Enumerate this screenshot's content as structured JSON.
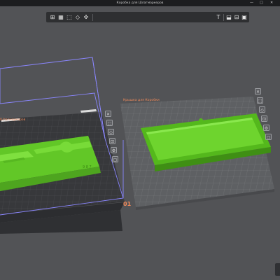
{
  "window": {
    "title": "Коробка для Шлагмаркеров",
    "controls": [
      "—",
      "□",
      "✕"
    ]
  },
  "toolbar": {
    "left_icons": [
      "add-object-icon",
      "grid-view-icon",
      "arrange-icon",
      "orient-icon",
      "settings-icon"
    ],
    "left_glyphs": [
      "⊞",
      "▦",
      "⬚",
      "◇",
      "✣"
    ],
    "right_icons": [
      "text-tool-icon",
      "cut-icon",
      "split-icon",
      "layers-icon",
      "variable-layer-icon"
    ],
    "right_glyphs": [
      "T",
      "⬓",
      "⊟",
      "▣",
      "◫"
    ]
  },
  "plates": [
    {
      "label": "Шлагмаркеров",
      "number": "01",
      "selected": true
    },
    {
      "label": "Крышка для Коробки",
      "selected": false
    }
  ],
  "plate_tools": {
    "icons": [
      "close-plate-icon",
      "arrange-plate-icon",
      "orient-plate-icon",
      "lock-plate-icon",
      "plate-settings-icon",
      "plate-type-icon"
    ],
    "glyphs": [
      "✕",
      "⬚",
      "◇",
      "⊡",
      "⚙",
      "▢"
    ]
  },
  "colors": {
    "background": "#525356",
    "model": "#6bd62d",
    "selection": "#8a86ff",
    "plate_accent": "#f08a5a"
  }
}
